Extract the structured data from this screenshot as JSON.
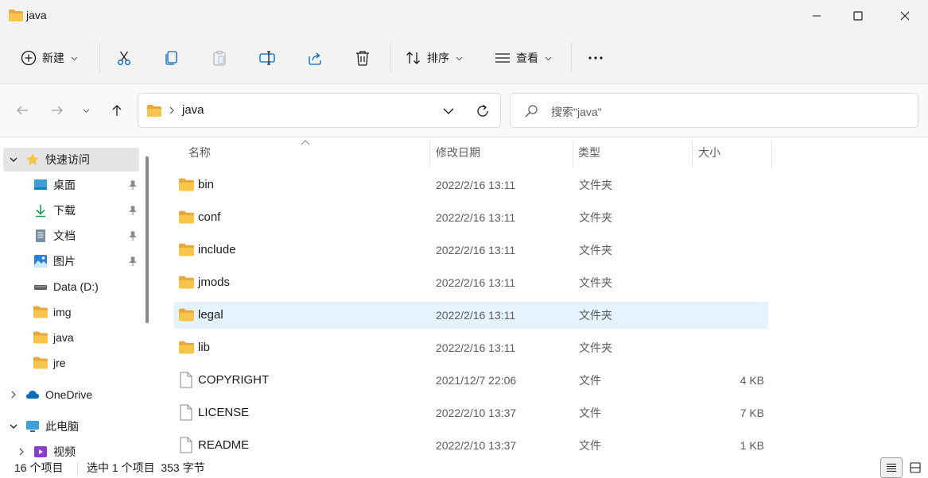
{
  "window": {
    "title": "java"
  },
  "toolbar": {
    "new_label": "新建",
    "sort_label": "排序",
    "view_label": "查看",
    "icons": [
      "plus-circle-icon",
      "cut-icon",
      "copy-icon",
      "paste-icon",
      "rename-icon",
      "share-icon",
      "delete-icon",
      "sort-icon",
      "view-icon",
      "more-icon"
    ]
  },
  "address": {
    "path_segment": "java",
    "search_placeholder": "搜索\"java\""
  },
  "sidebar": {
    "quick_access": "快速访问",
    "items": [
      {
        "label": "桌面",
        "icon": "desktop-icon",
        "pinned": true
      },
      {
        "label": "下载",
        "icon": "download-icon",
        "pinned": true
      },
      {
        "label": "文档",
        "icon": "document-icon",
        "pinned": true
      },
      {
        "label": "图片",
        "icon": "pictures-icon",
        "pinned": true
      },
      {
        "label": "Data (D:)",
        "icon": "drive-icon",
        "pinned": false
      },
      {
        "label": "img",
        "icon": "folder-icon",
        "pinned": false
      },
      {
        "label": "java",
        "icon": "folder-icon",
        "pinned": false
      },
      {
        "label": "jre",
        "icon": "folder-icon",
        "pinned": false
      }
    ],
    "onedrive": "OneDrive",
    "this_pc": "此电脑",
    "videos": "视频"
  },
  "list": {
    "headers": {
      "name": "名称",
      "date": "修改日期",
      "type": "类型",
      "size": "大小"
    },
    "rows": [
      {
        "name": "bin",
        "date": "2022/2/16 13:11",
        "type": "文件夹",
        "size": "",
        "kind": "folder"
      },
      {
        "name": "conf",
        "date": "2022/2/16 13:11",
        "type": "文件夹",
        "size": "",
        "kind": "folder"
      },
      {
        "name": "include",
        "date": "2022/2/16 13:11",
        "type": "文件夹",
        "size": "",
        "kind": "folder"
      },
      {
        "name": "jmods",
        "date": "2022/2/16 13:11",
        "type": "文件夹",
        "size": "",
        "kind": "folder"
      },
      {
        "name": "legal",
        "date": "2022/2/16 13:11",
        "type": "文件夹",
        "size": "",
        "kind": "folder",
        "selected": true
      },
      {
        "name": "lib",
        "date": "2022/2/16 13:11",
        "type": "文件夹",
        "size": "",
        "kind": "folder"
      },
      {
        "name": "COPYRIGHT",
        "date": "2021/12/7 22:06",
        "type": "文件",
        "size": "4 KB",
        "kind": "file"
      },
      {
        "name": "LICENSE",
        "date": "2022/2/10 13:37",
        "type": "文件",
        "size": "7 KB",
        "kind": "file"
      },
      {
        "name": "README",
        "date": "2022/2/10 13:37",
        "type": "文件",
        "size": "1 KB",
        "kind": "file"
      }
    ]
  },
  "status": {
    "item_count": "16 个项目",
    "selection": "选中 1 个项目  353 字节"
  },
  "colors": {
    "folder": "#f8c54b",
    "selection": "#e5f3ff",
    "accent": "#0067c0"
  }
}
